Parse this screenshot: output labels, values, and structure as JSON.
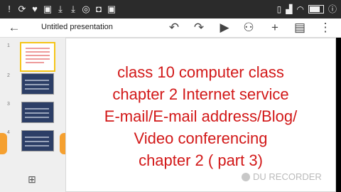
{
  "status_bar": {
    "left_icons": [
      "alert-icon",
      "sync-icon",
      "heart-icon",
      "image-icon",
      "download-icon",
      "download-icon",
      "whatsapp-icon",
      "instagram-icon",
      "image-icon"
    ],
    "right_icons": [
      "vibrate-icon",
      "signal-icon",
      "wifi-icon"
    ],
    "battery": "battery-icon",
    "time": "ⓘ"
  },
  "app_bar": {
    "title": "Untitled presentation",
    "icons": [
      "back-arrow-icon",
      "undo-icon",
      "redo-icon",
      "play-icon",
      "add-person-icon",
      "add-icon",
      "comment-icon",
      "more-vert-icon"
    ]
  },
  "slides_panel": {
    "slides": [
      {
        "number": "1",
        "style": "selected"
      },
      {
        "number": "2",
        "style": "dark"
      },
      {
        "number": "3",
        "style": "dark"
      },
      {
        "number": "4",
        "style": "dark"
      }
    ],
    "new_slide_icon": "new-slide-icon"
  },
  "slide": {
    "lines": [
      "class 10 computer class",
      "chapter 2 Internet service",
      "E-mail/E-mail address/Blog/",
      "Video conferencing",
      "chapter 2 ( part 3)"
    ],
    "text_color": "#d21818"
  },
  "watermark": {
    "text": "DU RECORDER"
  }
}
